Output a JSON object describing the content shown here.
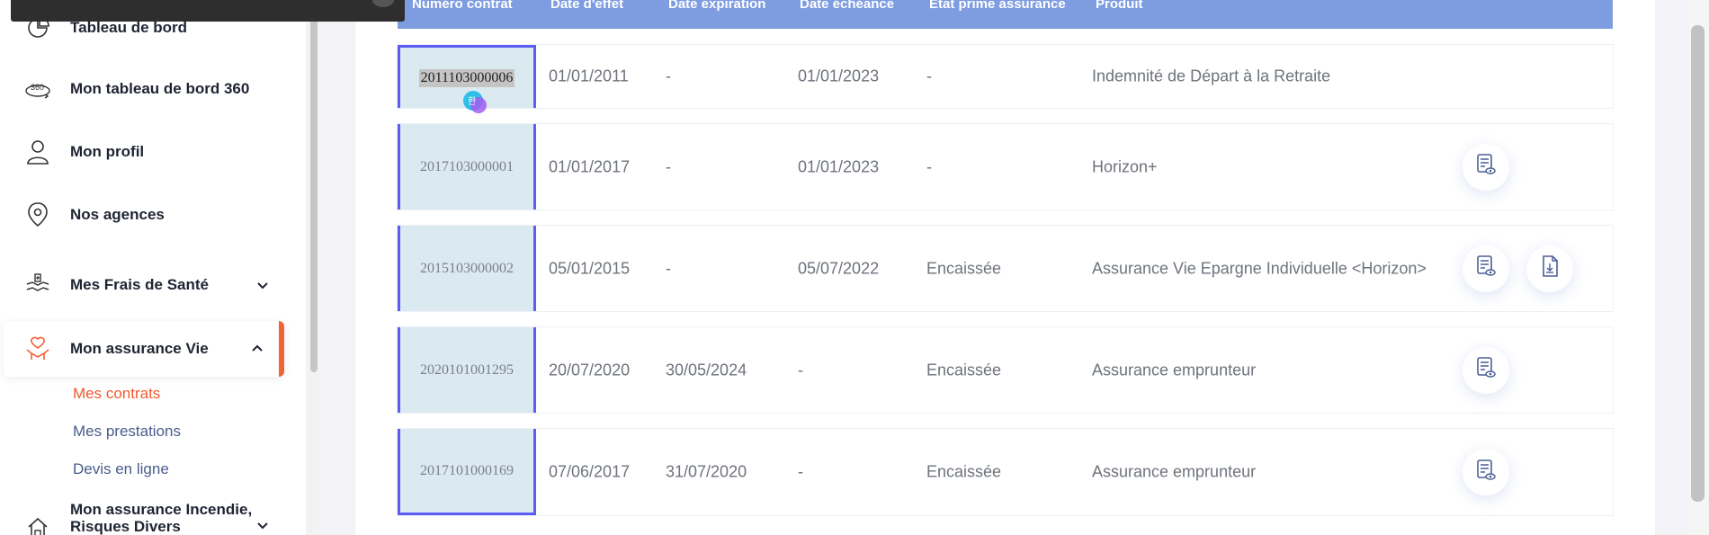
{
  "sidebar": {
    "items": [
      {
        "label": "Tableau de bord",
        "icon": "dashboard-icon"
      },
      {
        "label": "Mon tableau de bord 360",
        "icon": "dashboard-360-icon"
      },
      {
        "label": "Mon profil",
        "icon": "user-icon"
      },
      {
        "label": "Nos agences",
        "icon": "location-pin-icon"
      },
      {
        "label": "Mes Frais de Santé",
        "icon": "health-hands-icon"
      },
      {
        "label": "Mon assurance Vie",
        "icon": "life-insurance-icon"
      },
      {
        "label": "Mon assurance Incendie, Risques Divers",
        "icon": "home-icon"
      }
    ],
    "sub_items": [
      "Mes contrats",
      "Mes prestations",
      "Devis en ligne"
    ]
  },
  "table": {
    "columns": [
      "Numéro contrat",
      "Date d'effet",
      "Date expiration",
      "Date échéance",
      "Etat prime assurance",
      "Produit"
    ],
    "rows": [
      {
        "contract": "2011103000006",
        "effect": "01/01/2011",
        "expiration": "-",
        "due": "01/01/2023",
        "status": "-",
        "product": "Indemnité de Départ à la Retraite",
        "actions": []
      },
      {
        "contract": "2017103000001",
        "effect": "01/01/2017",
        "expiration": "-",
        "due": "01/01/2023",
        "status": "-",
        "product": "Horizon+",
        "actions": [
          "view-document-icon"
        ]
      },
      {
        "contract": "2015103000002",
        "effect": "05/01/2015",
        "expiration": "-",
        "due": "05/07/2022",
        "status": "Encaissée",
        "product": "Assurance Vie Epargne Individuelle <Horizon>",
        "actions": [
          "view-document-icon",
          "download-document-icon"
        ]
      },
      {
        "contract": "2020101001295",
        "effect": "20/07/2020",
        "expiration": "30/05/2024",
        "due": "-",
        "status": "Encaissée",
        "product": "Assurance emprunteur",
        "actions": [
          "view-document-icon"
        ]
      },
      {
        "contract": "2017101000169",
        "effect": "07/06/2017",
        "expiration": "31/07/2020",
        "due": "-",
        "status": "Encaissée",
        "product": "Assurance emprunteur",
        "actions": [
          "view-document-icon"
        ]
      }
    ]
  },
  "colors": {
    "accent": "#f16236",
    "header": "#7e9ce0",
    "id_cell": "#dbeaf1",
    "selection_border": "#5b5ef0"
  },
  "overlays": {
    "translate_badge_icon": "translate-icon"
  }
}
